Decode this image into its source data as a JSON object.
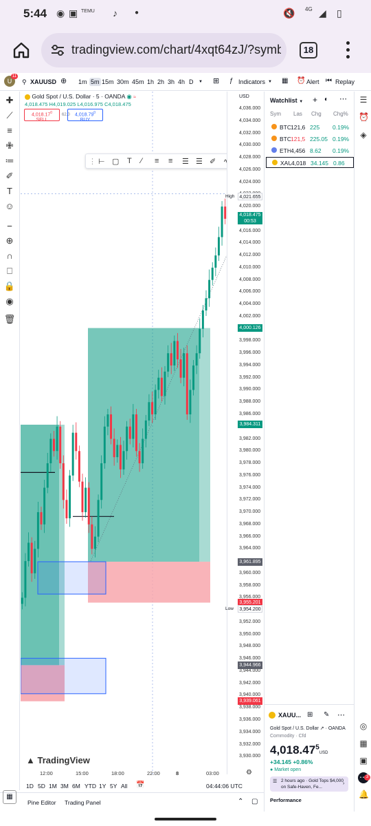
{
  "status_bar": {
    "time": "5:44",
    "notification_icons": [
      "messenger-icon",
      "instagram-icon",
      "temu-icon",
      "tiktok-icon",
      "dot-icon"
    ],
    "temu_text": "TEMU",
    "network": "4G",
    "right_icons": [
      "mute-icon",
      "signal-icon",
      "battery-icon"
    ]
  },
  "browser": {
    "url": "tradingview.com/chart/4xqt64zJ/?symb",
    "tab_count": "18"
  },
  "toolbar": {
    "avatar_badge": "11",
    "symbol": "XAUUSD",
    "timeframes": [
      "1m",
      "5m",
      "15m",
      "30m",
      "45m",
      "1h",
      "2h",
      "3h",
      "4h",
      "D"
    ],
    "active_timeframe": "5m",
    "indicators_label": "Indicators",
    "alert_label": "Alert",
    "replay_label": "Replay"
  },
  "legend": {
    "title": "Gold Spot / U.S. Dollar · 5 · OANDA",
    "open": "4,018.475",
    "high": "H4,019.025",
    "low": "L4,016.975",
    "close": "C4,018.475",
    "sell_price": "4,018.17",
    "sell_sup": "0",
    "sell_label": "SELL",
    "spread": "62.0",
    "buy_price": "4,018.79",
    "buy_sup": "0",
    "buy_label": "BUY"
  },
  "chart_data": {
    "type": "candlestick",
    "symbol": "XAUUSD",
    "title": "Gold Spot / U.S. Dollar · 5 · OANDA",
    "price_ticks": [
      4036,
      4034,
      4032,
      4030,
      4028,
      4026,
      4024,
      4022,
      4020,
      4018,
      4016,
      4014,
      4012,
      4010,
      4008,
      4006,
      4004,
      4002,
      4000,
      3998,
      3996,
      3994,
      3992,
      3990,
      3988,
      3986,
      3984,
      3982,
      3980,
      3978,
      3976,
      3974,
      3972,
      3970,
      3968,
      3966,
      3964,
      3962,
      3960,
      3958,
      3956,
      3954,
      3952,
      3950,
      3948,
      3946,
      3944,
      3942,
      3940,
      3938,
      3936,
      3934,
      3932,
      3930
    ],
    "tick_labels": [
      "4,036.000",
      "4,034.000",
      "4,032.000",
      "4,030.000",
      "4,028.000",
      "4,026.000",
      "4,024.000",
      "4,022.000",
      "4,020.000",
      "4,018.000",
      "4,016.000",
      "4,014.000",
      "4,012.000",
      "4,010.000",
      "4,008.000",
      "4,006.000",
      "4,004.000",
      "4,002.000",
      "4,000.000",
      "3,998.000",
      "3,996.000",
      "3,994.000",
      "3,992.000",
      "3,990.000",
      "3,988.000",
      "3,986.000",
      "3,984.000",
      "3,982.000",
      "3,980.000",
      "3,978.000",
      "3,976.000",
      "3,974.000",
      "3,972.000",
      "3,970.000",
      "3,968.000",
      "3,966.000",
      "3,964.000",
      "3,962.000",
      "3,960.000",
      "3,958.000",
      "3,956.000",
      "3,954.000",
      "3,952.000",
      "3,950.000",
      "3,948.000",
      "3,946.000",
      "3,944.000",
      "3,942.000",
      "3,940.000",
      "3,938.000",
      "3,936.000",
      "3,934.000",
      "3,932.000",
      "3,930.000"
    ],
    "ylim": [
      3929,
      4037
    ],
    "time_labels": [
      "12:00",
      "15:00",
      "18:00",
      "22:00",
      "8",
      "03:00"
    ],
    "price_tags": [
      {
        "label": "High",
        "value": "4,021.655",
        "price": 4021.655,
        "style": "outline"
      },
      {
        "value": "4,018.475",
        "sub": "00:53",
        "price": 4018.475,
        "style": "current"
      },
      {
        "value": "4,000.126",
        "price": 4000.126,
        "style": "green"
      },
      {
        "value": "3,984.311",
        "price": 3984.311,
        "style": "green"
      },
      {
        "value": "3,961.895",
        "price": 3961.895,
        "style": "gray"
      },
      {
        "value": "3,955.201",
        "price": 3955.201,
        "style": "red"
      },
      {
        "label": "Low",
        "value": "3,954.200",
        "price": 3954.2,
        "style": "outline"
      },
      {
        "value": "3,944.966",
        "price": 3944.966,
        "style": "gray"
      },
      {
        "value": "3,939.061",
        "price": 3939.061,
        "style": "red"
      }
    ],
    "positions": [
      {
        "side": "long",
        "entry": 3984.2,
        "target": 4000.126,
        "stop": 3955.201
      },
      {
        "side": "long",
        "entry": 3944.966,
        "target": 3984.311,
        "stop": 3939.061
      }
    ],
    "zones": [
      {
        "type": "blue-box",
        "top": 3961.895,
        "bottom": 3956.6
      },
      {
        "type": "blue-box",
        "top": 3946.1,
        "bottom": 3940.3
      }
    ],
    "close_series": [
      3956,
      3962,
      3965,
      3960,
      3964,
      3970,
      3968,
      3974,
      3978,
      3982,
      3980,
      3984,
      3978,
      3972,
      3969,
      3976,
      3983,
      3980,
      3975,
      3970,
      3974,
      3968,
      3964,
      3966,
      3972,
      3978,
      3984,
      3986,
      3982,
      3979,
      3981,
      3977,
      3980,
      3984,
      3982,
      3986,
      3980,
      3978,
      3982,
      3985,
      3988,
      3986,
      3990,
      3992,
      3989,
      3993,
      3996,
      3994,
      3998,
      3995,
      3992,
      3996,
      3986,
      3990,
      3994,
      3996,
      4000,
      4003,
      4005,
      4008,
      4010,
      4012,
      4015,
      4020,
      4018
    ]
  },
  "bottom": {
    "ranges": [
      "1D",
      "5D",
      "1M",
      "3M",
      "6M",
      "YTD",
      "1Y",
      "5Y",
      "All"
    ],
    "clock": "04:44:06 UTC",
    "tabs": [
      "Pine Editor",
      "Trading Panel"
    ],
    "logo_text": "TradingView"
  },
  "watchlist": {
    "title": "Watchlist",
    "columns": [
      "Sym",
      "Las",
      "Chg",
      "Chg%"
    ],
    "rows": [
      {
        "sym": "BTC",
        "last": "121,6",
        "chg": "225",
        "pct": "0.19%",
        "color": "#f7931a",
        "last_color": "#131722"
      },
      {
        "sym": "BTC",
        "last": "121,5",
        "chg": "225.05",
        "pct": "0.19%",
        "color": "#f7931a",
        "last_color": "#f23645"
      },
      {
        "sym": "ETH",
        "last": "4,456",
        "chg": "8.62",
        "pct": "0.19%",
        "color": "#627eea",
        "last_color": "#131722"
      },
      {
        "sym": "XAU",
        "last": "4,018",
        "chg": "34.145",
        "pct": "0.86",
        "color": "#f2b90a",
        "last_color": "#131722"
      }
    ]
  },
  "details": {
    "symbol": "XAUU...",
    "name": "Gold Spot / U.S. Dollar",
    "exchange": "OANDA",
    "type": "Commodity",
    "type2": "Cfd",
    "price": "4,018.47",
    "price_sup": "5",
    "currency": "USD",
    "change": "+34.145",
    "change_pct": "+0.86%",
    "market_status": "Market open",
    "news_time": "2 hours ago",
    "news_text": "Gold Tops $4,000 on Safe-Haven, Fe...",
    "performance": "Performance",
    "notif_badge": "3"
  }
}
